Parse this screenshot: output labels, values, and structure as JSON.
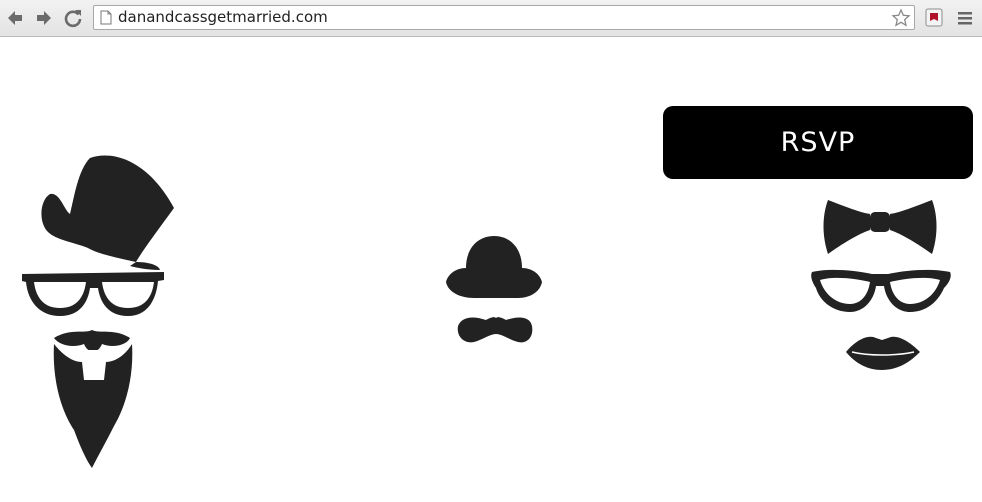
{
  "browser": {
    "url": "danandcassgetmarried.com",
    "icons": [
      "back-icon",
      "forward-icon",
      "reload-icon",
      "page-icon",
      "star-icon",
      "extension-icon",
      "menu-icon"
    ]
  },
  "page": {
    "rsvp_label": "RSVP",
    "illustrations": [
      "groom-top-hat-beard",
      "bowler-hat-mustache",
      "bride-bowtie-glasses-lips"
    ]
  },
  "colors": {
    "ink": "#222222",
    "button_bg": "#000000",
    "button_text": "#ffffff"
  }
}
